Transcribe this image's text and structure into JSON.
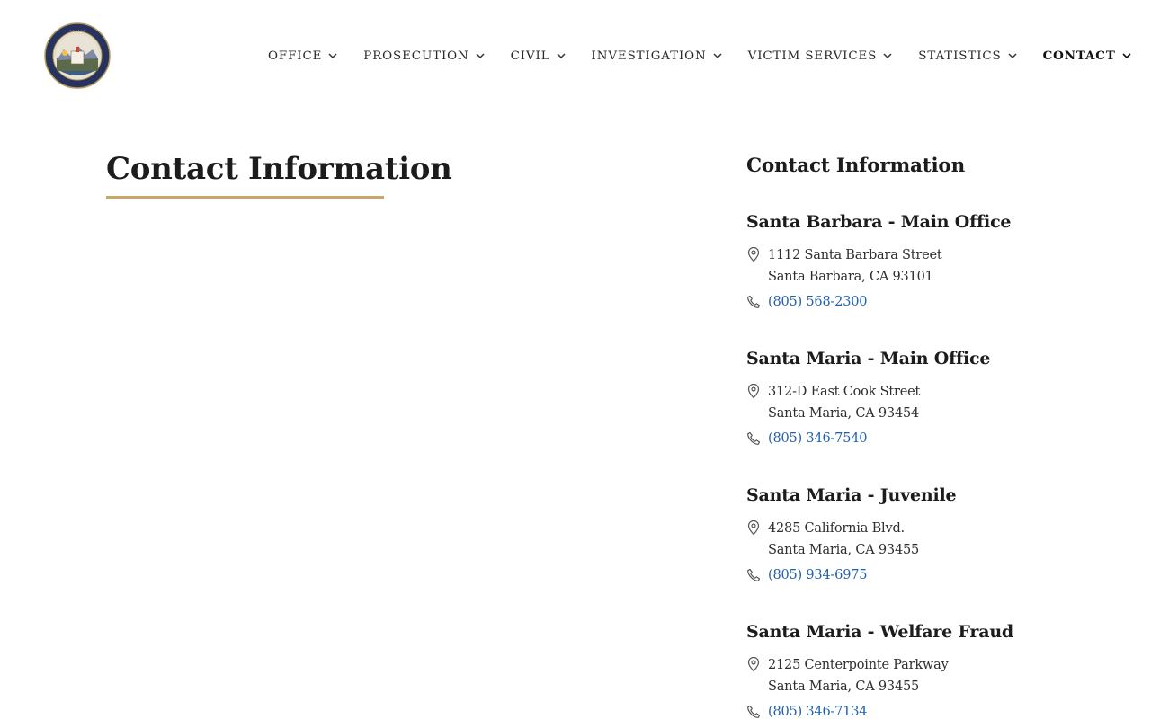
{
  "header": {
    "logo_text": "DISTRICT ATTORNEY · SANTA BARBARA COUNTY",
    "nav": [
      {
        "label": "OFFICE"
      },
      {
        "label": "PROSECUTION"
      },
      {
        "label": "CIVIL"
      },
      {
        "label": "INVESTIGATION"
      },
      {
        "label": "VICTIM SERVICES"
      },
      {
        "label": "STATISTICS"
      },
      {
        "label": "CONTACT"
      }
    ]
  },
  "main": {
    "title": "Contact Information"
  },
  "sidebar": {
    "title": "Contact Information",
    "offices": [
      {
        "name": "Santa Barbara - Main Office",
        "address1": "1112 Santa Barbara Street",
        "address2": "Santa Barbara, CA 93101",
        "phone": "(805) 568-2300"
      },
      {
        "name": "Santa Maria - Main Office",
        "address1": "312-D East Cook Street",
        "address2": "Santa Maria, CA 93454",
        "phone": "(805) 346-7540"
      },
      {
        "name": "Santa Maria - Juvenile",
        "address1": "4285 California Blvd.",
        "address2": "Santa Maria, CA 93455",
        "phone": "(805) 934-6975"
      },
      {
        "name": "Santa Maria - Welfare Fraud",
        "address1": "2125 Centerpointe Parkway",
        "address2": "Santa Maria, CA 93455",
        "phone": "(805) 346-7134"
      }
    ]
  },
  "colors": {
    "accent_gold": "#c9a66b",
    "link_blue": "#1f5fb0",
    "seal_navy": "#27335e"
  },
  "icons": {
    "location": "location-pin-icon",
    "phone": "phone-icon",
    "dropdown": "chevron-down-icon"
  }
}
